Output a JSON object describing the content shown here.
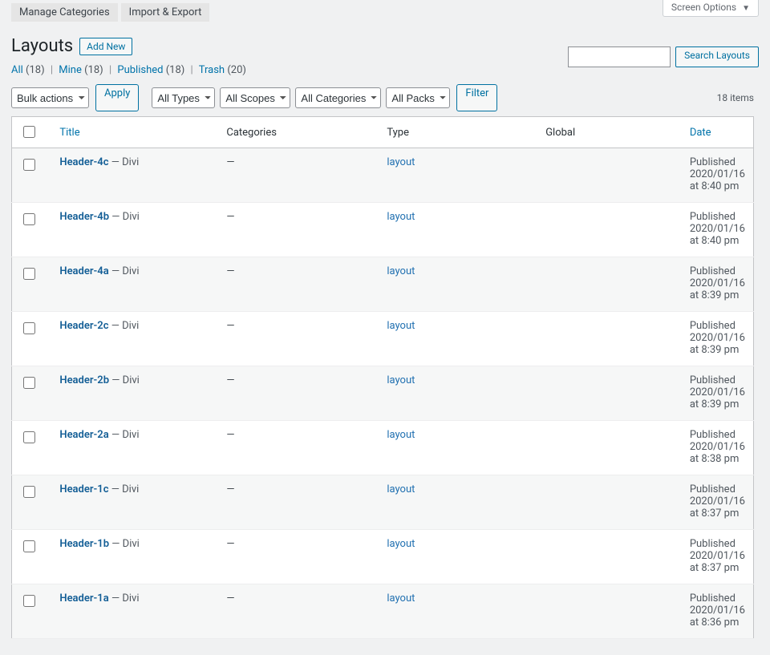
{
  "screen_options_label": "Screen Options",
  "top_tabs": [
    "Manage Categories",
    "Import & Export"
  ],
  "page_title": "Layouts",
  "add_new_label": "Add New",
  "views": {
    "all": {
      "label": "All",
      "count": "(18)"
    },
    "mine": {
      "label": "Mine",
      "count": "(18)"
    },
    "published": {
      "label": "Published",
      "count": "(18)"
    },
    "trash": {
      "label": "Trash",
      "count": "(20)"
    }
  },
  "search": {
    "placeholder": "",
    "button": "Search Layouts"
  },
  "bulk_actions_label": "Bulk actions",
  "apply_label": "Apply",
  "filters": {
    "types": "All Types",
    "scopes": "All Scopes",
    "categories": "All Categories",
    "packs": "All Packs",
    "button": "Filter"
  },
  "items_count_label": "18 items",
  "columns": {
    "title": "Title",
    "categories": "Categories",
    "type": "Type",
    "global": "Global",
    "date": "Date"
  },
  "rows": [
    {
      "title": "Header-4c",
      "builder": "Divi",
      "categories": "—",
      "type": "layout",
      "status": "Published",
      "date": "2020/01/16 at 8:40 pm"
    },
    {
      "title": "Header-4b",
      "builder": "Divi",
      "categories": "—",
      "type": "layout",
      "status": "Published",
      "date": "2020/01/16 at 8:40 pm"
    },
    {
      "title": "Header-4a",
      "builder": "Divi",
      "categories": "—",
      "type": "layout",
      "status": "Published",
      "date": "2020/01/16 at 8:39 pm"
    },
    {
      "title": "Header-2c",
      "builder": "Divi",
      "categories": "—",
      "type": "layout",
      "status": "Published",
      "date": "2020/01/16 at 8:39 pm"
    },
    {
      "title": "Header-2b",
      "builder": "Divi",
      "categories": "—",
      "type": "layout",
      "status": "Published",
      "date": "2020/01/16 at 8:39 pm"
    },
    {
      "title": "Header-2a",
      "builder": "Divi",
      "categories": "—",
      "type": "layout",
      "status": "Published",
      "date": "2020/01/16 at 8:38 pm"
    },
    {
      "title": "Header-1c",
      "builder": "Divi",
      "categories": "—",
      "type": "layout",
      "status": "Published",
      "date": "2020/01/16 at 8:37 pm"
    },
    {
      "title": "Header-1b",
      "builder": "Divi",
      "categories": "—",
      "type": "layout",
      "status": "Published",
      "date": "2020/01/16 at 8:37 pm"
    },
    {
      "title": "Header-1a",
      "builder": "Divi",
      "categories": "—",
      "type": "layout",
      "status": "Published",
      "date": "2020/01/16 at 8:36 pm"
    }
  ]
}
